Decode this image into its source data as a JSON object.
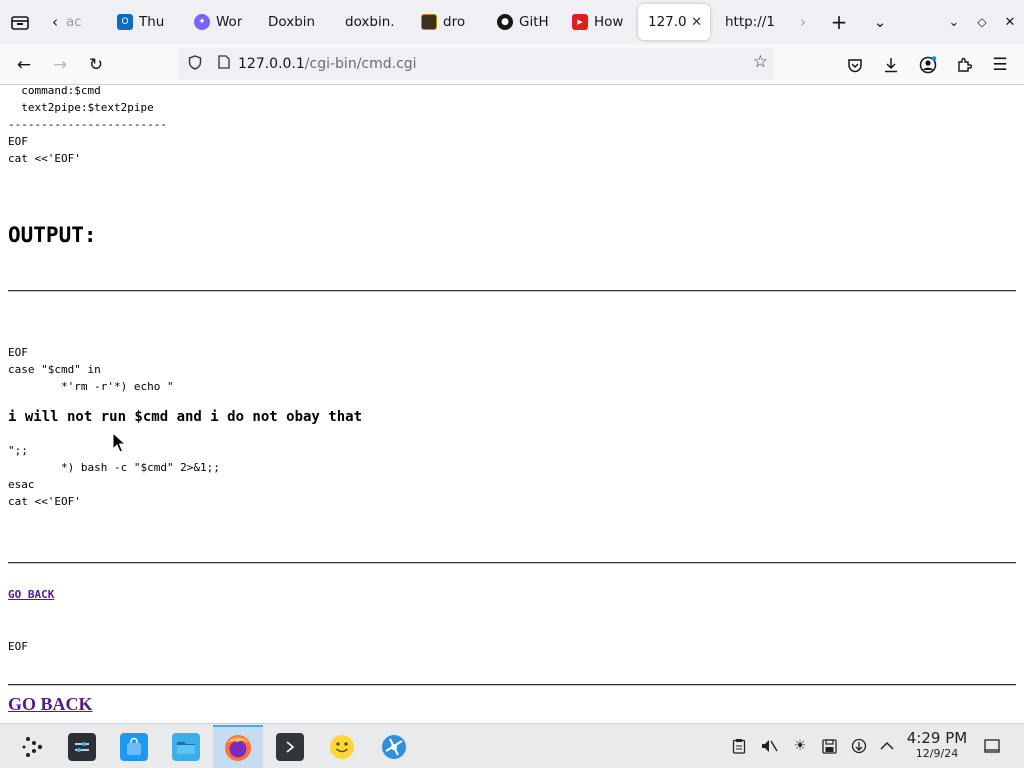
{
  "tabs": {
    "items": [
      {
        "label": "ac",
        "favicon": "chevron-left-icon"
      },
      {
        "label": "Thu",
        "favicon": "outlook-icon",
        "color": "#0f6cbd"
      },
      {
        "label": "Wor",
        "favicon": "copilot-icon",
        "color": "#7b61ff"
      },
      {
        "label": "Doxbin",
        "favicon": ""
      },
      {
        "label": "doxbin.",
        "favicon": ""
      },
      {
        "label": "dro",
        "favicon": "dark-site-icon",
        "color": "#3b2f1e"
      },
      {
        "label": "GitH",
        "favicon": "github-icon",
        "color": "#181717"
      },
      {
        "label": "How",
        "favicon": "red-site-icon",
        "color": "#e01e1e"
      },
      {
        "label": "127.0",
        "favicon": "",
        "active": true
      },
      {
        "label": "http://1",
        "favicon": ""
      }
    ]
  },
  "navbar": {
    "url_host": "127.0.0.1",
    "url_path": "/cgi-bin/cmd.cgi"
  },
  "content": {
    "block1": "  command:$cmd\n  text2pipe:$text2pipe\n------------------------\nEOF\ncat <<'EOF'",
    "heading": "OUTPUT:",
    "block2": "EOF\ncase \"$cmd\" in\n        *'rm -r'*) echo \"",
    "bold_line": "i will not run $cmd and i do not obay that",
    "block3": "\";;\n        *) bash -c \"$cmd\" 2>&1;;\nesac\ncat <<'EOF'",
    "link_small": "GO BACK",
    "block4": "EOF",
    "link_big": "GO BACK"
  },
  "taskbar": {
    "apps": [
      {
        "name": "app-launcher-icon"
      },
      {
        "name": "system-settings-icon"
      },
      {
        "name": "discover-store-icon"
      },
      {
        "name": "file-manager-icon"
      },
      {
        "name": "firefox-icon",
        "active": true
      },
      {
        "name": "terminal-icon"
      },
      {
        "name": "smiley-app-icon"
      },
      {
        "name": "network-app-icon"
      }
    ],
    "time": "4:29 PM",
    "date": "12/9/24"
  }
}
